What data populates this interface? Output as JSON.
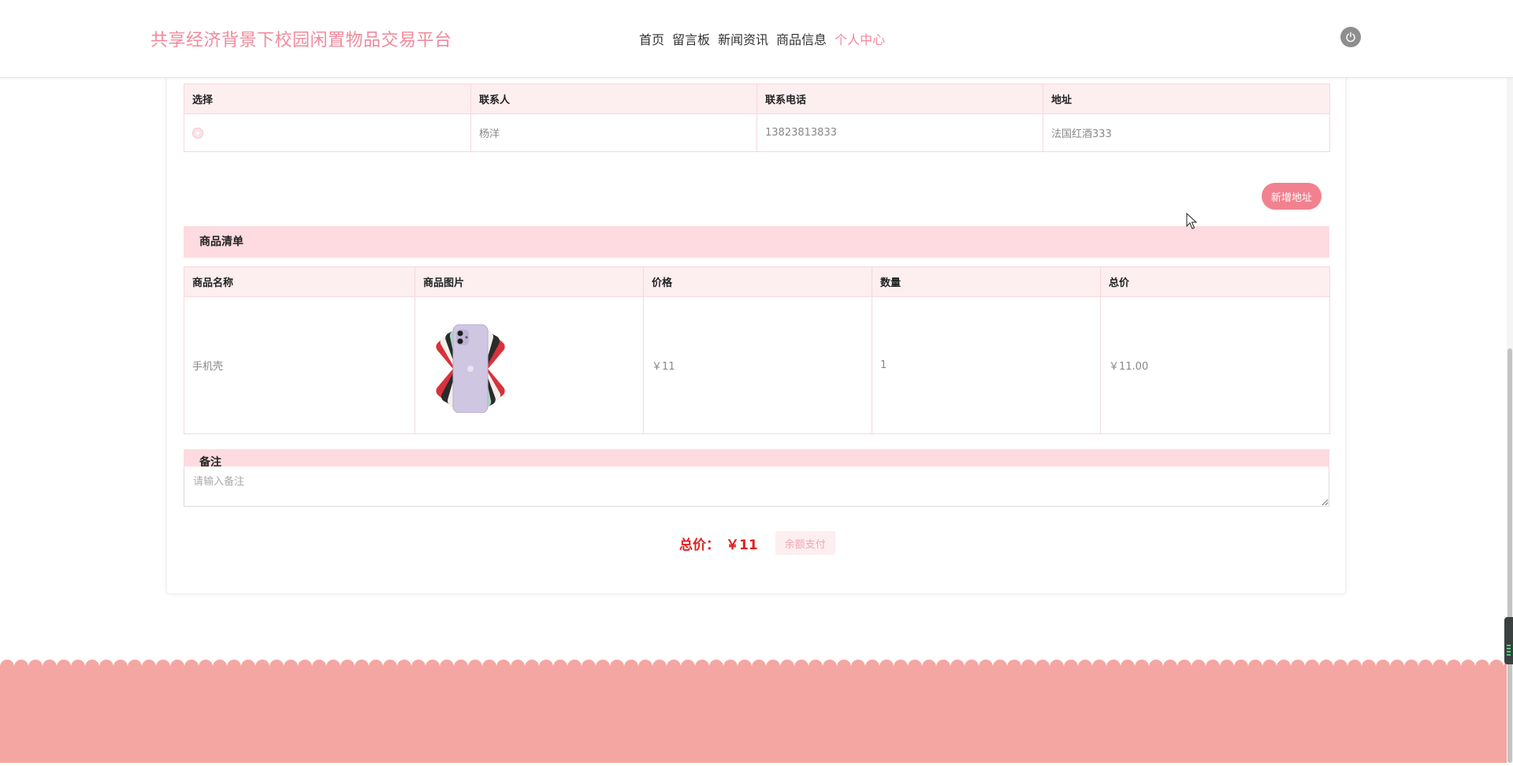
{
  "header": {
    "site_title": "共享经济背景下校园闲置物品交易平台",
    "nav": [
      {
        "label": "首页",
        "active": false
      },
      {
        "label": "留言板",
        "active": false
      },
      {
        "label": "新闻资讯",
        "active": false
      },
      {
        "label": "商品信息",
        "active": false
      },
      {
        "label": "个人中心",
        "active": true
      }
    ],
    "power_icon": "power-icon"
  },
  "address": {
    "columns": [
      "选择",
      "联系人",
      "联系电话",
      "地址"
    ],
    "rows": [
      {
        "contact": "杨洋",
        "phone": "13823813833",
        "address": "法国红酒333"
      }
    ],
    "add_button": "新增地址"
  },
  "goods": {
    "section_title": "商品清单",
    "columns": [
      "商品名称",
      "商品图片",
      "价格",
      "数量",
      "总价"
    ],
    "rows": [
      {
        "name": "手机壳",
        "image_icon": "phone-case-image",
        "price": "￥11",
        "quantity": "1",
        "total": "￥11.00"
      }
    ]
  },
  "remark": {
    "section_title": "备注",
    "placeholder": "请输入备注"
  },
  "summary": {
    "total_label": "总价：",
    "total_value": "￥11",
    "pay_button": "余额支付"
  },
  "colors": {
    "brand": "#f08a9c",
    "accent_button": "#f2818f",
    "section_bg": "#fddbe0",
    "header_row_bg": "#fdeef0",
    "total_text": "#e02020",
    "footer_wave": "#f4a6a2"
  }
}
